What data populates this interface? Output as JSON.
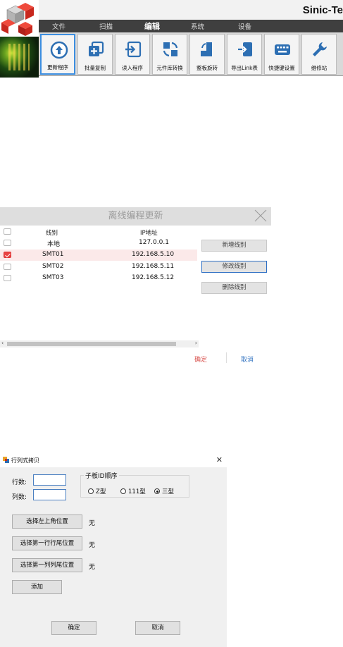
{
  "app": {
    "brand": "Sinic-Te",
    "menu": [
      "文件",
      "扫描",
      "编辑",
      "系统",
      "设备"
    ],
    "active_menu_index": 2,
    "toolbar": [
      {
        "label": "更新程序",
        "icon": "upload-circle-icon",
        "active": true
      },
      {
        "label": "批量复制",
        "icon": "batch-copy-icon",
        "active": false
      },
      {
        "label": "读入程序",
        "icon": "import-icon",
        "active": false
      },
      {
        "label": "元件库转换",
        "icon": "convert-icon",
        "active": false
      },
      {
        "label": "整板旋转",
        "icon": "rotate-board-icon",
        "active": false
      },
      {
        "label": "导出Link表",
        "icon": "export-icon",
        "active": false
      },
      {
        "label": "快捷键设置",
        "icon": "keyboard-icon",
        "active": false
      },
      {
        "label": "维修站",
        "icon": "wrench-icon",
        "active": false
      }
    ]
  },
  "offline_dialog": {
    "title": "离线编程更新",
    "columns": [
      "线别",
      "IP地址"
    ],
    "rows": [
      {
        "line": "本地",
        "ip": "127.0.0.1",
        "checked": false
      },
      {
        "line": "SMT01",
        "ip": "192.168.5.10",
        "checked": true
      },
      {
        "line": "SMT02",
        "ip": "192.168.5.11",
        "checked": false
      },
      {
        "line": "SMT03",
        "ip": "192.168.5.12",
        "checked": false
      }
    ],
    "buttons": {
      "add": "新增线别",
      "modify": "修改线别",
      "delete": "删除线别"
    },
    "ok": "确定",
    "cancel": "取消",
    "accent_ok": "#d9534f",
    "accent_cancel": "#3a78c3"
  },
  "copy_dialog": {
    "title": "行列式拷贝",
    "rows_label": "行数:",
    "cols_label": "列数:",
    "rows_value": "",
    "cols_value": "",
    "group_label": "子板ID顺序",
    "radios": [
      {
        "label": "Z型",
        "checked": false
      },
      {
        "label": "111型",
        "checked": false
      },
      {
        "label": "三型",
        "checked": true
      }
    ],
    "select_buttons": [
      {
        "label": "选择左上角位置",
        "status": "无"
      },
      {
        "label": "选择第一行行尾位置",
        "status": "无"
      },
      {
        "label": "选择第一列列尾位置",
        "status": "无"
      }
    ],
    "add": "添加",
    "ok": "确定",
    "cancel": "取消"
  }
}
